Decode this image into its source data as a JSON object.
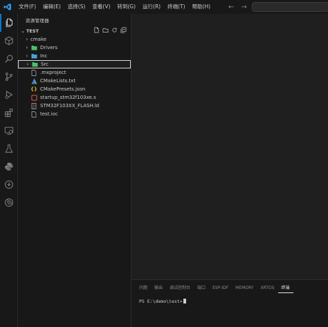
{
  "menu": [
    "文件(F)",
    "编辑(E)",
    "选择(S)",
    "查看(V)",
    "转到(G)",
    "运行(R)",
    "终端(T)",
    "帮助(H)"
  ],
  "nav": {
    "back": "←",
    "forward": "→"
  },
  "sidebar": {
    "title": "资源管理器",
    "project": "TEST",
    "tree": [
      {
        "name": "cmake",
        "type": "folder"
      },
      {
        "name": "Drivers",
        "type": "folder"
      },
      {
        "name": "Inc",
        "type": "folder-inc"
      },
      {
        "name": "Src",
        "type": "folder-src"
      },
      {
        "name": ".mxproject",
        "type": "file"
      },
      {
        "name": "CMakeLists.txt",
        "type": "cmake"
      },
      {
        "name": "CMakePresets.json",
        "type": "json"
      },
      {
        "name": "startup_stm32f103xe.s",
        "type": "asm"
      },
      {
        "name": "STM32F103XX_FLASH.ld",
        "type": "ld"
      },
      {
        "name": "test.ioc",
        "type": "file"
      }
    ]
  },
  "panel": {
    "tabs": [
      "问题",
      "输出",
      "调试控制台",
      "端口",
      "ESP-IDF",
      "MEMORY",
      "XRTOS",
      "终端"
    ],
    "terminal_prompt": "PS E:\\demo\\test>"
  },
  "colors": {
    "accent": "#0078d4",
    "folder_icon_green": "#4cbf6a",
    "folder_icon_blue": "#4aa3df",
    "cmake_icon": "#e44c4c",
    "json_icon": "#e6b422",
    "asm_icon": "#e05a3a"
  }
}
